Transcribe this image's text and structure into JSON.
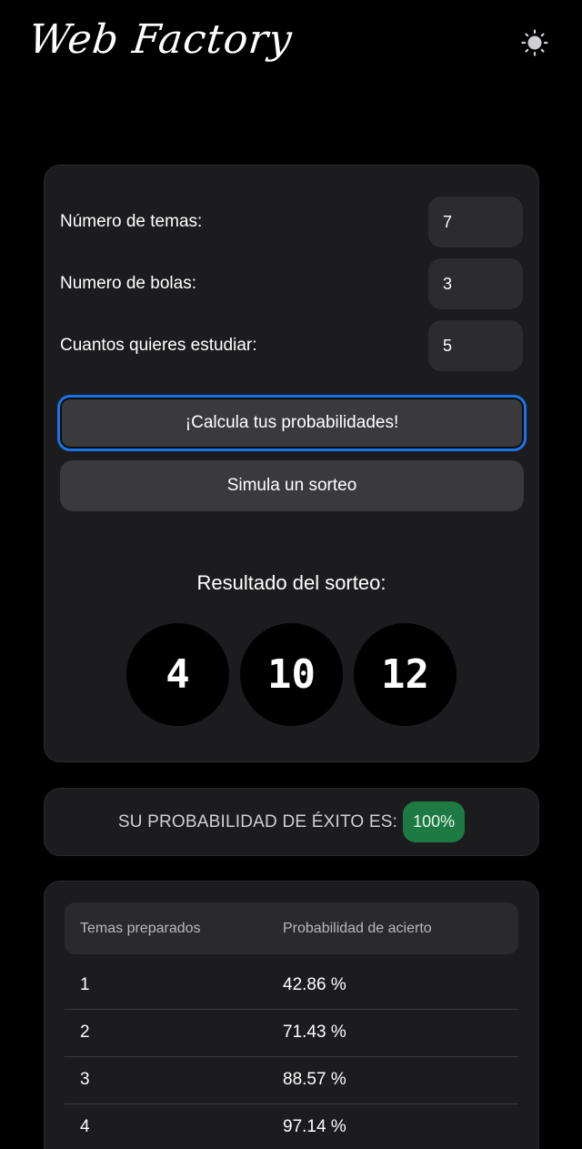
{
  "header": {
    "logo_text": "Web Factory",
    "theme_icon": "sun-icon"
  },
  "form": {
    "fields": [
      {
        "label": "Número de temas:",
        "value": "7"
      },
      {
        "label": "Numero de bolas:",
        "value": "3"
      },
      {
        "label": "Cuantos quieres estudiar:",
        "value": "5"
      }
    ],
    "calculate_label": "¡Calcula tus probabilidades!",
    "simulate_label": "Simula un sorteo"
  },
  "draw": {
    "title": "Resultado del sorteo:",
    "balls": [
      "4",
      "10",
      "12"
    ]
  },
  "probability": {
    "label": "SU PROBABILIDAD DE ÉXITO ES:",
    "value": "100%",
    "badge_color": "#1e7a43"
  },
  "table": {
    "headers": [
      "Temas preparados",
      "Probabilidad de acierto"
    ],
    "rows": [
      [
        "1",
        "42.86 %"
      ],
      [
        "2",
        "71.43 %"
      ],
      [
        "3",
        "88.57 %"
      ],
      [
        "4",
        "97.14 %"
      ]
    ]
  },
  "colors": {
    "background": "#000000",
    "card": "#1c1c1e",
    "focus_ring": "#1a73e8"
  }
}
